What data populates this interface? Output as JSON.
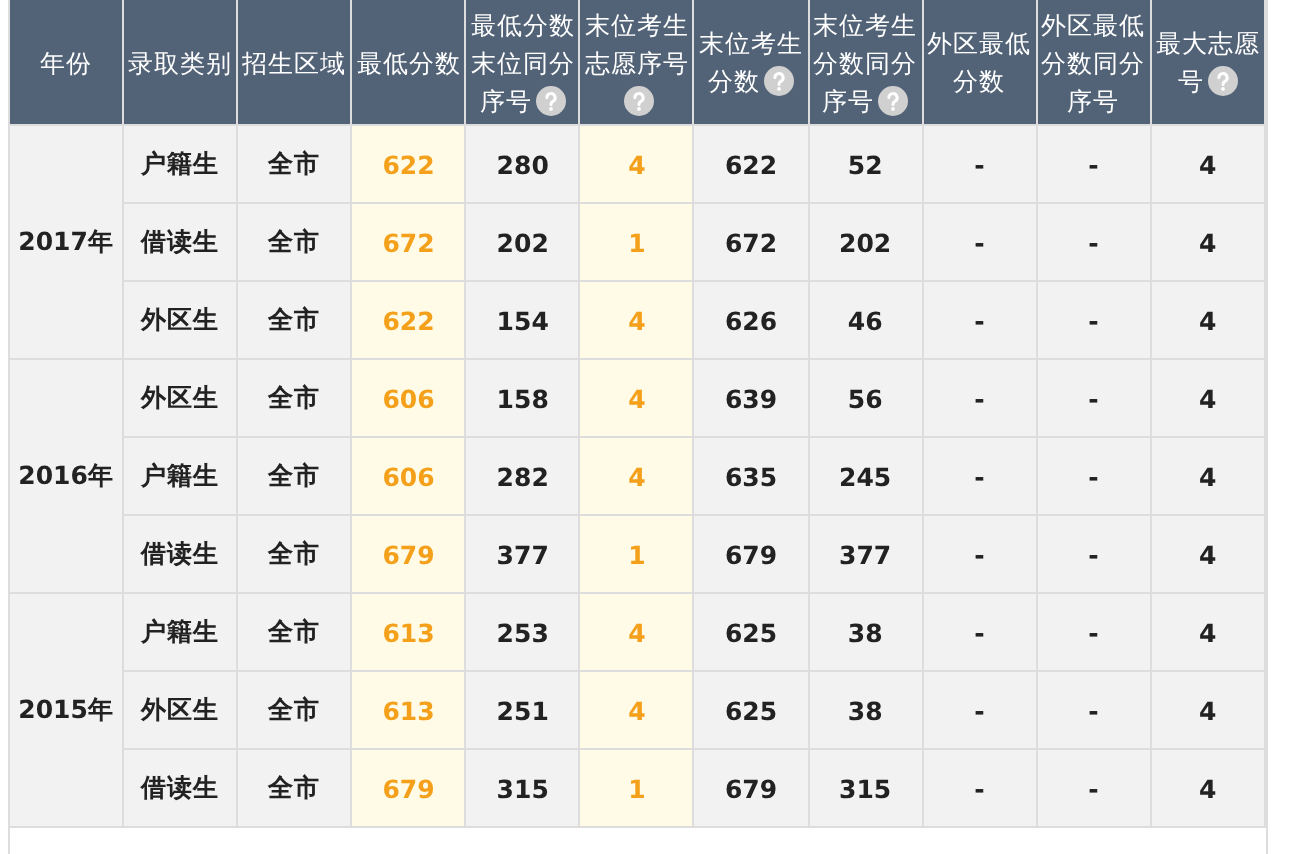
{
  "table": {
    "columns": [
      {
        "label": "年份",
        "help": false,
        "highlighted": false
      },
      {
        "label": "录取类别",
        "help": false,
        "highlighted": false
      },
      {
        "label": "招生区域",
        "help": false,
        "highlighted": false
      },
      {
        "label": "最低分数",
        "help": false,
        "highlighted": true
      },
      {
        "label": "最低分数末位同分序号",
        "help": true,
        "highlighted": false
      },
      {
        "label": "末位考生志愿序号",
        "help": true,
        "highlighted": true
      },
      {
        "label": "末位考生分数",
        "help": true,
        "highlighted": false
      },
      {
        "label": "末位考生分数同分序号",
        "help": true,
        "highlighted": false
      },
      {
        "label": "外区最低分数",
        "help": false,
        "highlighted": false
      },
      {
        "label": "外区最低分数同分序号",
        "help": false,
        "highlighted": false
      },
      {
        "label": "最大志愿号",
        "help": true,
        "highlighted": false
      }
    ],
    "groups": [
      {
        "year": "2017年",
        "rows": [
          [
            "户籍生",
            "全市",
            "622",
            "280",
            "4",
            "622",
            "52",
            "-",
            "-",
            "4"
          ],
          [
            "借读生",
            "全市",
            "672",
            "202",
            "1",
            "672",
            "202",
            "-",
            "-",
            "4"
          ],
          [
            "外区生",
            "全市",
            "622",
            "154",
            "4",
            "626",
            "46",
            "-",
            "-",
            "4"
          ]
        ]
      },
      {
        "year": "2016年",
        "rows": [
          [
            "外区生",
            "全市",
            "606",
            "158",
            "4",
            "639",
            "56",
            "-",
            "-",
            "4"
          ],
          [
            "户籍生",
            "全市",
            "606",
            "282",
            "4",
            "635",
            "245",
            "-",
            "-",
            "4"
          ],
          [
            "借读生",
            "全市",
            "679",
            "377",
            "1",
            "679",
            "377",
            "-",
            "-",
            "4"
          ]
        ]
      },
      {
        "year": "2015年",
        "rows": [
          [
            "户籍生",
            "全市",
            "613",
            "253",
            "4",
            "625",
            "38",
            "-",
            "-",
            "4"
          ],
          [
            "外区生",
            "全市",
            "613",
            "251",
            "4",
            "625",
            "38",
            "-",
            "-",
            "4"
          ],
          [
            "借读生",
            "全市",
            "679",
            "315",
            "1",
            "679",
            "315",
            "-",
            "-",
            "4"
          ]
        ]
      }
    ]
  }
}
